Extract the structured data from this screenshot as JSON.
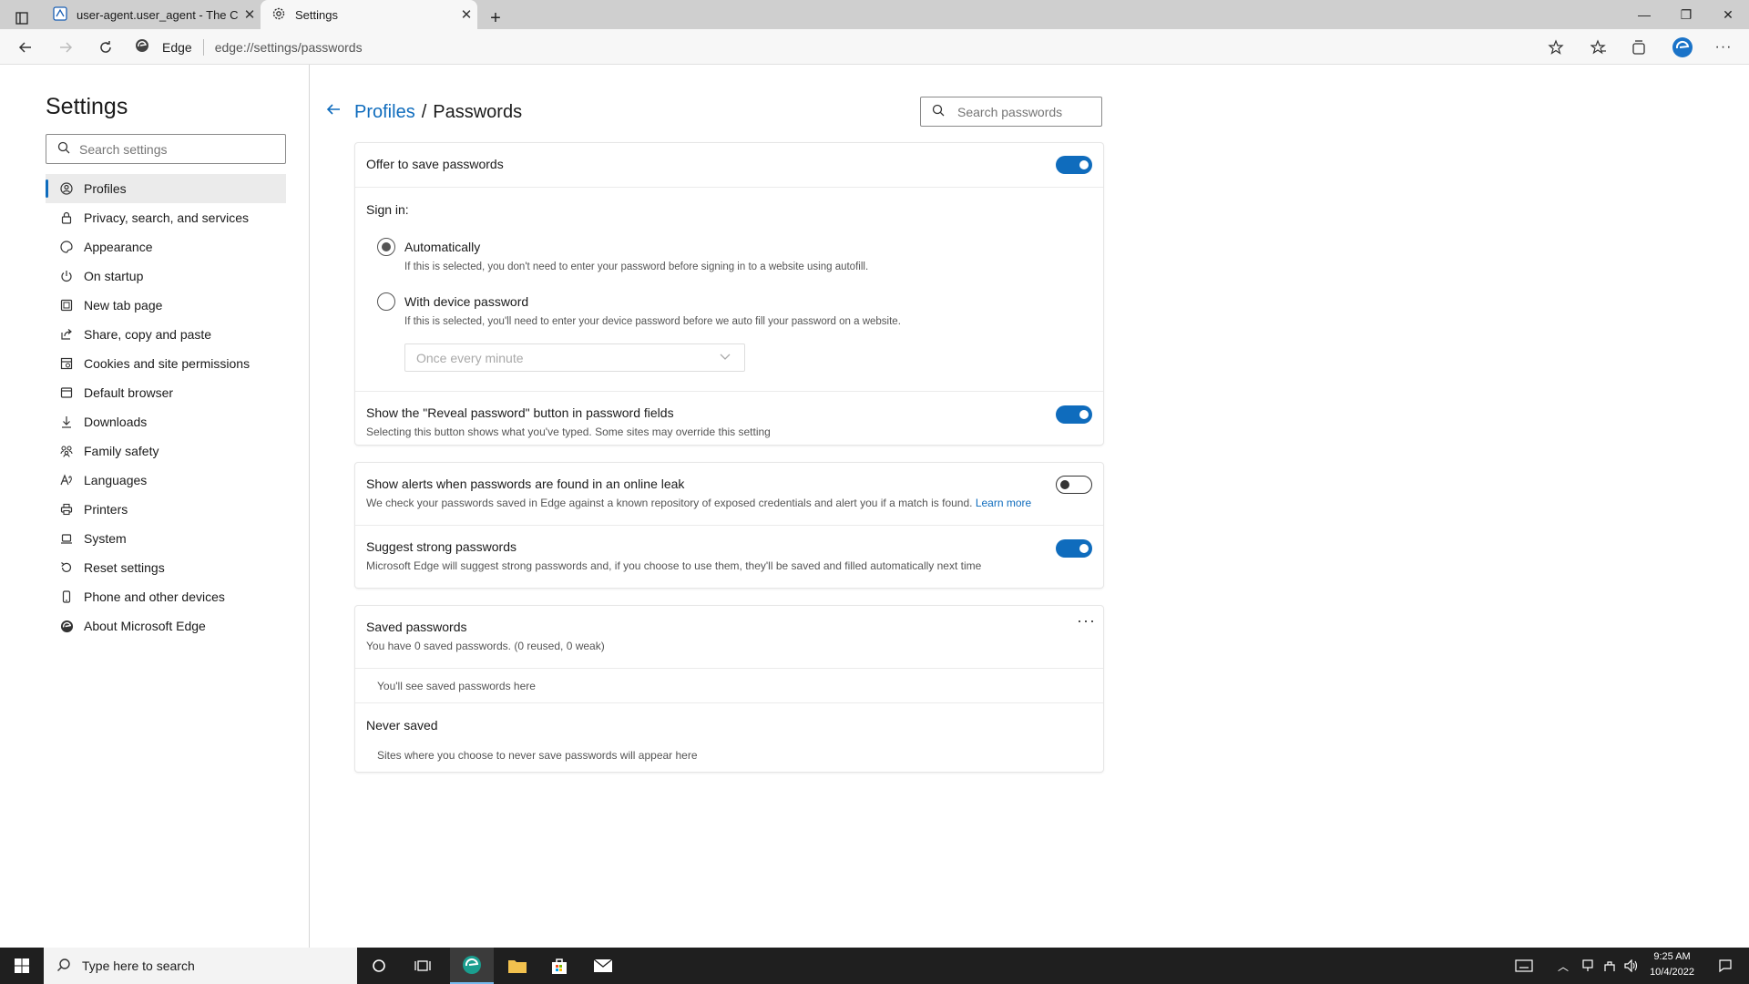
{
  "browser": {
    "tabs": [
      {
        "title": "user-agent.user_agent - The Coll",
        "icon": "page-icon"
      },
      {
        "title": "Settings",
        "icon": "gear-icon"
      }
    ],
    "address_brand": "Edge",
    "url": "edge://settings/passwords"
  },
  "sidebar": {
    "title": "Settings",
    "search_placeholder": "Search settings",
    "items": [
      {
        "label": "Profiles",
        "icon": "profile-icon"
      },
      {
        "label": "Privacy, search, and services",
        "icon": "lock-icon"
      },
      {
        "label": "Appearance",
        "icon": "palette-icon"
      },
      {
        "label": "On startup",
        "icon": "power-icon"
      },
      {
        "label": "New tab page",
        "icon": "new-tab-icon"
      },
      {
        "label": "Share, copy and paste",
        "icon": "share-icon"
      },
      {
        "label": "Cookies and site permissions",
        "icon": "cookie-icon"
      },
      {
        "label": "Default browser",
        "icon": "browser-icon"
      },
      {
        "label": "Downloads",
        "icon": "download-icon"
      },
      {
        "label": "Family safety",
        "icon": "family-icon"
      },
      {
        "label": "Languages",
        "icon": "language-icon"
      },
      {
        "label": "Printers",
        "icon": "printer-icon"
      },
      {
        "label": "System",
        "icon": "laptop-icon"
      },
      {
        "label": "Reset settings",
        "icon": "reset-icon"
      },
      {
        "label": "Phone and other devices",
        "icon": "phone-icon"
      },
      {
        "label": "About Microsoft Edge",
        "icon": "edge-icon"
      }
    ]
  },
  "main": {
    "breadcrumb_link": "Profiles",
    "breadcrumb_sep": "/",
    "breadcrumb_current": "Passwords",
    "search_placeholder": "Search passwords",
    "offer_save": {
      "label": "Offer to save passwords",
      "enabled": true
    },
    "sign_in": {
      "heading": "Sign in:",
      "auto_label": "Automatically",
      "auto_desc": "If this is selected, you don't need to enter your password before signing in to a website using autofill.",
      "device_label": "With device password",
      "device_desc": "If this is selected, you'll need to enter your device password before we auto fill your password on a website.",
      "frequency": "Once every minute",
      "selected": "Automatically"
    },
    "reveal": {
      "label": "Show the \"Reveal password\" button in password fields",
      "desc": "Selecting this button shows what you've typed. Some sites may override this setting",
      "enabled": true
    },
    "leak": {
      "label": "Show alerts when passwords are found in an online leak",
      "desc": "We check your passwords saved in Edge against a known repository of exposed credentials and alert you if a match is found.",
      "link": "Learn more",
      "enabled": false
    },
    "suggest": {
      "label": "Suggest strong passwords",
      "desc": "Microsoft Edge will suggest strong passwords and, if you choose to use them, they'll be saved and filled automatically next time",
      "enabled": true
    },
    "saved": {
      "title": "Saved passwords",
      "summary": "You have 0 saved passwords. (0 reused, 0 weak)",
      "empty": "You'll see saved passwords here"
    },
    "never": {
      "title": "Never saved",
      "empty": "Sites where you choose to never save passwords will appear here"
    }
  },
  "taskbar": {
    "search_placeholder": "Type here to search",
    "time": "9:25 AM",
    "date": "10/4/2022"
  },
  "colors": {
    "accent": "#0f6cbd",
    "taskbar": "#1f1f1f"
  }
}
